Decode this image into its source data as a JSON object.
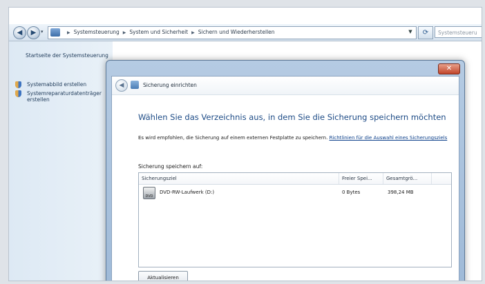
{
  "address_bar": {
    "breadcrumbs": [
      "Systemsteuerung",
      "System und Sicherheit",
      "Sichern und Wiederherstellen"
    ],
    "search_placeholder": "Systemsteueru"
  },
  "left_panel": {
    "home_link": "Startseite der Systemsteuerung",
    "items": [
      "Systemabbild erstellen",
      "Systemreparaturdatenträger erstellen"
    ]
  },
  "dialog": {
    "title": "Sicherung einrichten",
    "instruction": "Wählen Sie das Verzeichnis aus, in dem Sie die Sicherung speichern möchten",
    "recommendation_text": "Es wird empfohlen, die Sicherung auf einem externen Festplatte zu speichern.",
    "recommendation_link": "Richtlinien für die Auswahl eines Sicherungsziels",
    "save_location_label": "Sicherung speichern auf:",
    "table": {
      "columns": [
        "Sicherungsziel",
        "Freier Spei...",
        "Gesamtgrö..."
      ],
      "rows": [
        {
          "name": "DVD-RW-Laufwerk (D:)",
          "free": "0 Bytes",
          "total": "398,24 MB",
          "icon": "dvd-drive-icon"
        }
      ]
    },
    "refresh_button": "Aktualisieren"
  },
  "colors": {
    "accent_blue": "#1d4b86",
    "dialog_frame": "#9fbad8",
    "close_button": "#c2452a"
  }
}
